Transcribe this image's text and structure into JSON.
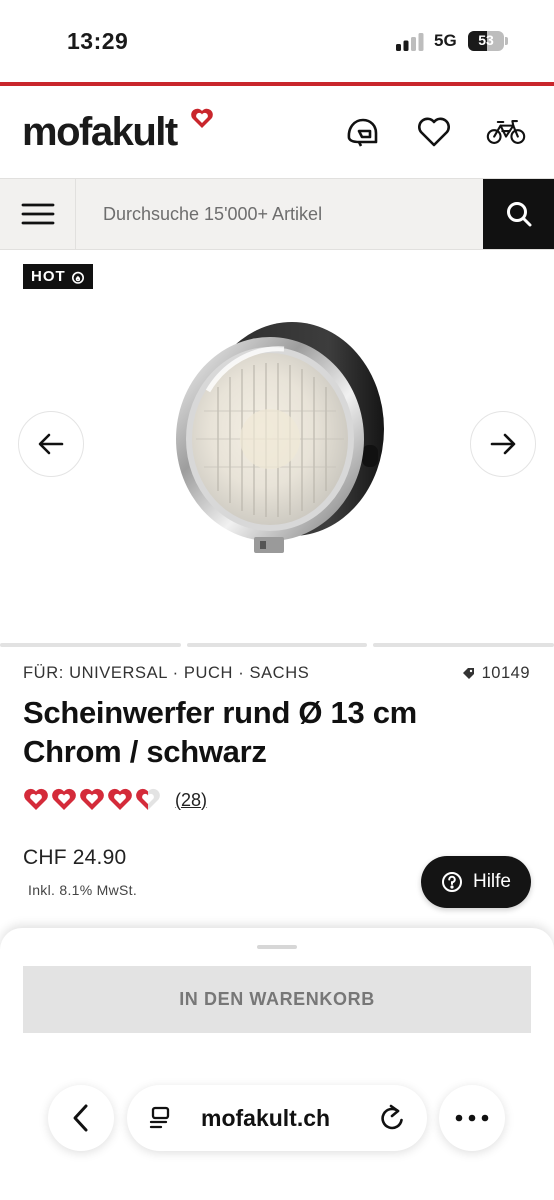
{
  "status_bar": {
    "time": "13:29",
    "network": "5G",
    "battery_level": "53",
    "battery_fraction": 0.53
  },
  "colors": {
    "brand_red": "#c9262c",
    "dark": "#111111",
    "rating_red": "#d42b3a"
  },
  "header": {
    "logo": "mofakult",
    "icons": [
      "helmet-icon",
      "heart-icon",
      "bicycle-icon"
    ]
  },
  "search": {
    "placeholder": "Durchsuche 15'000+ Artikel"
  },
  "gallery": {
    "badge": "HOT",
    "image_count": 3,
    "active_index": 0
  },
  "product": {
    "brands": "FÜR: UNIVERSAL · PUCH · SACHS",
    "sku": "10149",
    "title": "Scheinwerfer rund Ø 13 cm Chrom / schwarz",
    "rating": 4.5,
    "rating_count": "(28)",
    "price": "CHF 24.90",
    "vat_note": "Inkl. 8.1% MwSt."
  },
  "help": {
    "label": "Hilfe"
  },
  "cart": {
    "label": "IN DEN WARENKORB"
  },
  "browser": {
    "url": "mofakult.ch"
  }
}
